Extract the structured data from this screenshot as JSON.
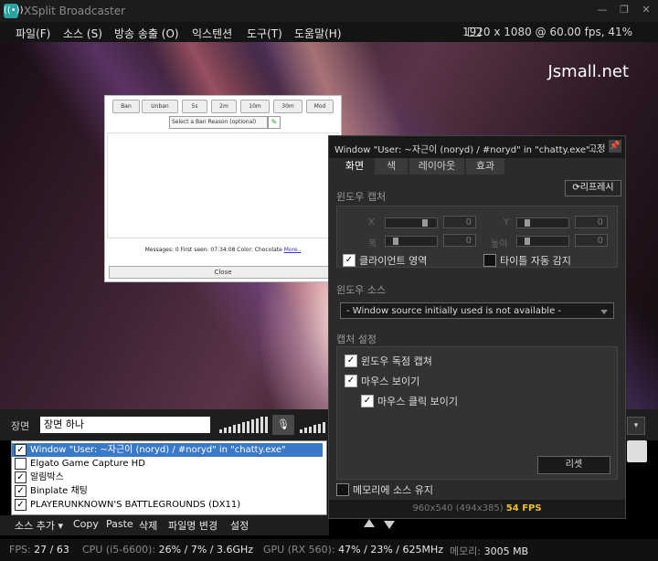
{
  "app": {
    "title": "XSplit Broadcaster",
    "icon": "broadcast-icon"
  },
  "menu": [
    {
      "label": "파일(F)"
    },
    {
      "label": "소스 (S)"
    },
    {
      "label": "방송 송출 (O)"
    },
    {
      "label": "익스텐션"
    },
    {
      "label": "도구(T)"
    },
    {
      "label": "도움말(H)"
    }
  ],
  "resolution_info": "1920 x 1080 @ 60.00 fps, 41%",
  "preview": {
    "watermark": "Jsmall.net",
    "chatty": {
      "buttons": [
        "Ban",
        "Unban",
        "5s",
        "2m",
        "10m",
        "30m",
        "Mod"
      ],
      "reason_select": "Select a Ban Reason (optional)",
      "status_text": "Messages: 0   First seen: 07:34:08   Color: Chocolate",
      "more_link": "More..",
      "close_label": "Close"
    }
  },
  "scene": {
    "label": "장면",
    "value": "장면 하나"
  },
  "sources": [
    {
      "name": "Window \"User: ~자근이 (noryd) / #noryd\" in \"chatty.exe\" process",
      "checked": true,
      "selected": true
    },
    {
      "name": "Elgato Game Capture HD",
      "checked": false,
      "selected": false
    },
    {
      "name": "알림박스",
      "checked": true,
      "selected": false
    },
    {
      "name": "Binplate 채팅",
      "checked": true,
      "selected": false
    },
    {
      "name": "PLAYERUNKNOWN'S BATTLEGROUNDS (DX11)",
      "checked": true,
      "selected": false
    }
  ],
  "source_tools": {
    "add": "소스 추가 ▾",
    "copy": "Copy",
    "paste": "Paste",
    "delete": "삭제",
    "rename": "파일명 변경",
    "settings": "설정"
  },
  "status": {
    "fps_label": "FPS:",
    "fps_value": "27 / 63",
    "cpu_label": "CPU (i5-6600):",
    "cpu_value": "26% / 7% / 3.6GHz",
    "gpu_label": "GPU (RX 560):",
    "gpu_value": "47% / 23% / 625MHz",
    "mem_label": "메모리:",
    "mem_value": "3005 MB"
  },
  "panel": {
    "title": "Window \"User: ~자근이 (noryd) / #noryd\" in \"chatty.exe\" ...",
    "fix_label": "고정",
    "tabs": [
      {
        "label": "화면"
      },
      {
        "label": "색"
      },
      {
        "label": "레이아웃"
      },
      {
        "label": "효과"
      }
    ],
    "capture_title": "윈도우 캡처",
    "refresh_label": "리프레시",
    "x_label": "X",
    "y_label": "Y",
    "w_label": "폭",
    "h_label": "높이",
    "x_value": "0",
    "y_value": "0",
    "w_value": "0",
    "h_value": "0",
    "client_area": "클라이언트 영역",
    "title_autodetect": "타이틀 자동 감지",
    "source_title": "윈도우 소스",
    "source_dropdown": "- Window source initially used is not available -",
    "capture_settings_title": "캡처 설정",
    "exclusive_capture": "윈도우 독점 캡쳐",
    "show_mouse": "마우스 보이기",
    "show_mouse_click": "마우스 클릭 보이기",
    "reset_label": "리셋",
    "keep_in_memory": "메모리에 소스 유지",
    "footer_res": "960x540 (494x385)",
    "footer_fps": "54 FPS"
  }
}
